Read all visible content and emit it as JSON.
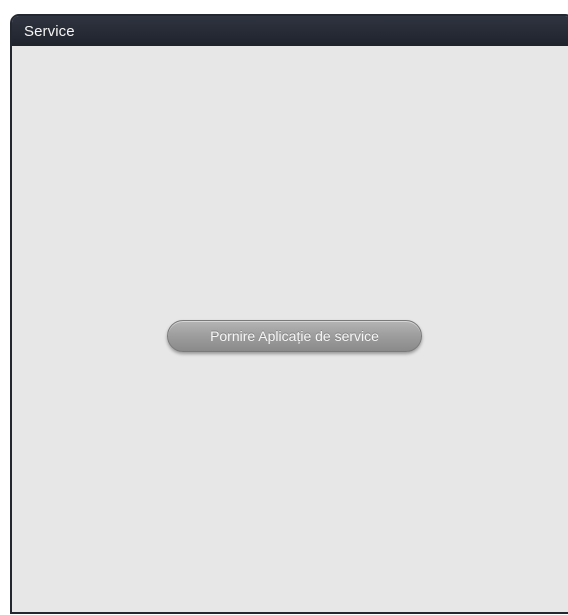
{
  "window": {
    "title": "Service"
  },
  "main": {
    "start_button_label": "Pornire Aplicație de service"
  },
  "colors": {
    "titlebar": "#1f232c",
    "background": "#e7e7e7",
    "button": "#9f9f9f"
  }
}
